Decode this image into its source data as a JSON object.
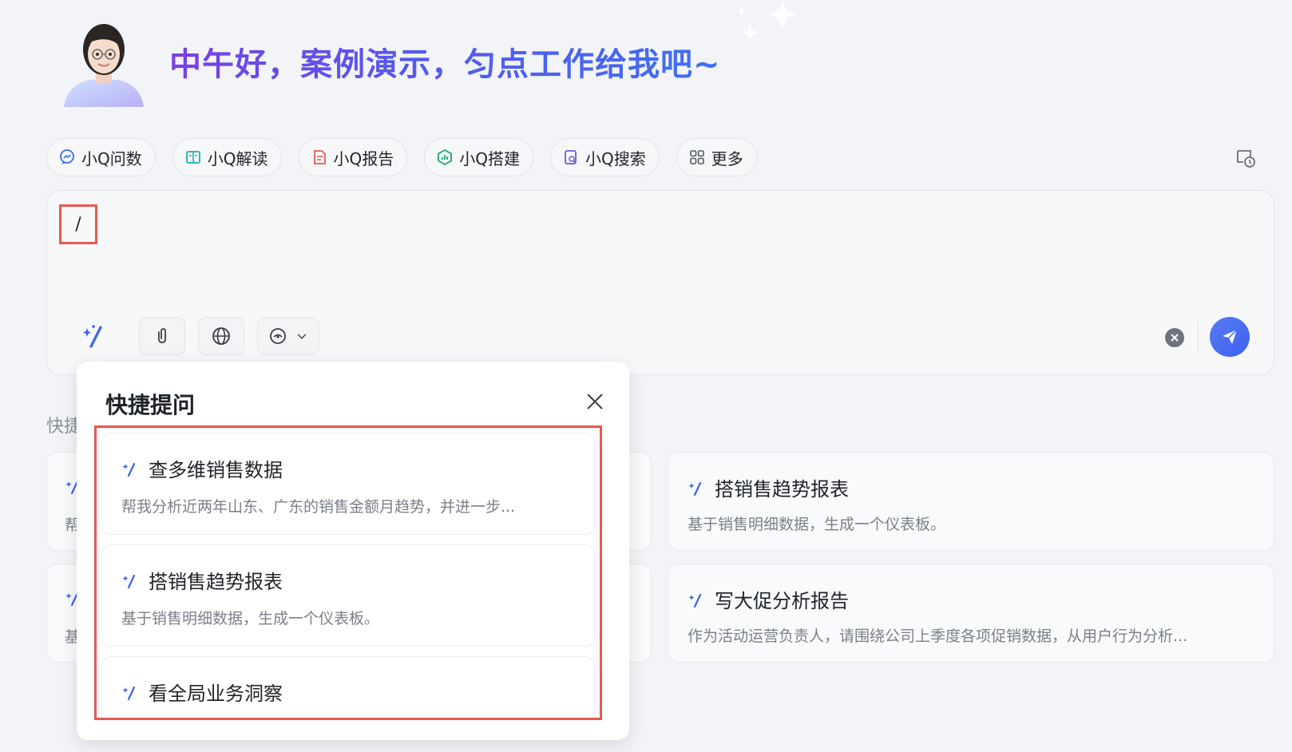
{
  "header": {
    "greeting": "中午好，案例演示，匀点工作给我吧~"
  },
  "tools": [
    {
      "label": "小Q问数",
      "icon": "chat-data-icon",
      "color": "#3b6df0"
    },
    {
      "label": "小Q解读",
      "icon": "book-icon",
      "color": "#19b3a8"
    },
    {
      "label": "小Q报告",
      "icon": "report-icon",
      "color": "#e8584f"
    },
    {
      "label": "小Q搭建",
      "icon": "dashboard-icon",
      "color": "#1aa86b"
    },
    {
      "label": "小Q搜索",
      "icon": "doc-search-icon",
      "color": "#6b5bd6"
    },
    {
      "label": "更多",
      "icon": "grid-icon",
      "color": "#555a64"
    }
  ],
  "input": {
    "value": "/"
  },
  "quick": {
    "section_label": "快捷",
    "left_cards": [
      {
        "title_partial": "",
        "desc_partial": "帮"
      },
      {
        "title_partial": "",
        "desc_partial": "基"
      }
    ],
    "right_cards": [
      {
        "title": "搭销售趋势报表",
        "desc": "基于销售明细数据，生成一个仪表板。"
      },
      {
        "title": "写大促分析报告",
        "desc": "作为活动运营负责人，请围绕公司上季度各项促销数据，从用户行为分析..."
      }
    ]
  },
  "popup": {
    "title": "快捷提问",
    "items": [
      {
        "title": "查多维销售数据",
        "desc": "帮我分析近两年山东、广东的销售金额月趋势，并进一步..."
      },
      {
        "title": "搭销售趋势报表",
        "desc": "基于销售明细数据，生成一个仪表板。"
      },
      {
        "title": "看全局业务洞察",
        "desc": ""
      }
    ]
  },
  "colors": {
    "accent": "#3b63ef",
    "highlight": "#e8584f"
  }
}
